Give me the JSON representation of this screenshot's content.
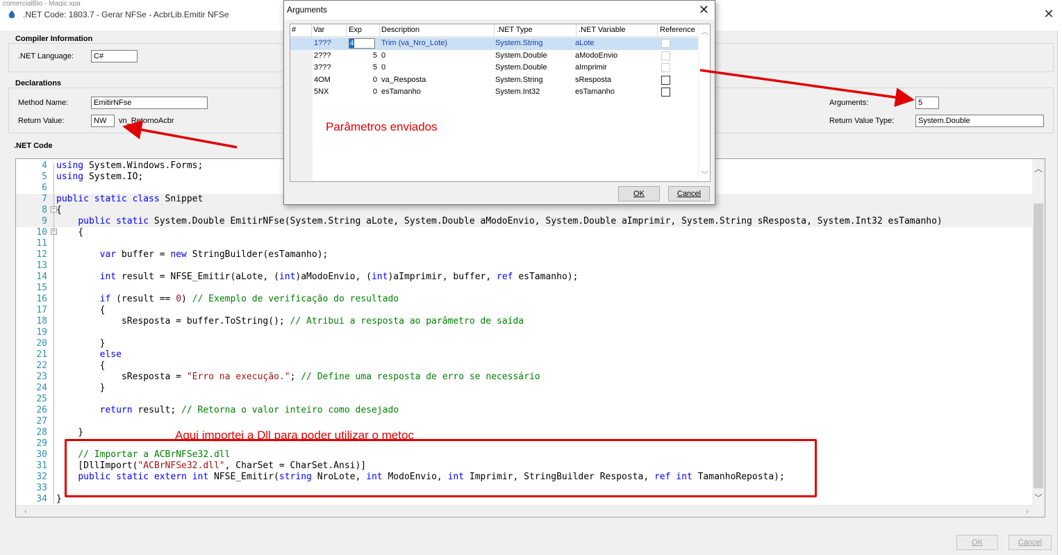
{
  "background_window": {
    "title_fragment": "comercialBio - Magic.xpa"
  },
  "window": {
    "title": ".NET Code: 1803.7 -   Gerar NFSe - AcbrLib.Emitir NFSe",
    "close_glyph": "✕"
  },
  "compiler": {
    "section_label": "Compiler Information",
    "language_label": ".NET Language:",
    "language_value": "C#"
  },
  "declarations": {
    "section_label": "Declarations",
    "method_name_label": "Method Name:",
    "method_name_value": "EmitirNFse",
    "return_value_label": "Return Value:",
    "return_value_var": "NW",
    "return_value_name": "vn_RetornoAcbr",
    "arguments_label": "Arguments:",
    "arguments_value": "5",
    "return_type_label": "Return Value Type:",
    "return_type_value": "System.Double"
  },
  "code_section": {
    "label": ".NET Code"
  },
  "code_lines": [
    {
      "n": "4",
      "t": [
        [
          "kw",
          "using"
        ],
        [
          "tx",
          " System.Windows.Forms;"
        ]
      ]
    },
    {
      "n": "5",
      "t": [
        [
          "kw",
          "using"
        ],
        [
          "tx",
          " System.IO;"
        ]
      ]
    },
    {
      "n": "6",
      "t": []
    },
    {
      "n": "7",
      "t": [
        [
          "kw",
          "public static class"
        ],
        [
          "tx",
          " Snippet"
        ]
      ],
      "hl": true
    },
    {
      "n": "8",
      "t": [
        [
          "tx",
          "{"
        ]
      ],
      "hl": true,
      "fold": true
    },
    {
      "n": "9",
      "t": [
        [
          "tx",
          "    "
        ],
        [
          "kw",
          "public static"
        ],
        [
          "tx",
          " System.Double EmitirNFse(System.String aLote, System.Double aModoEnvio, System.Double aImprimir, System.String sResposta, System.Int32 esTamanho)"
        ]
      ],
      "hl": true
    },
    {
      "n": "10",
      "t": [
        [
          "tx",
          "    {"
        ]
      ],
      "fold": true
    },
    {
      "n": "11",
      "t": []
    },
    {
      "n": "12",
      "t": [
        [
          "tx",
          "        "
        ],
        [
          "kw",
          "var"
        ],
        [
          "tx",
          " buffer = "
        ],
        [
          "kw",
          "new"
        ],
        [
          "tx",
          " StringBuilder(esTamanho);"
        ]
      ]
    },
    {
      "n": "13",
      "t": []
    },
    {
      "n": "14",
      "t": [
        [
          "tx",
          "        "
        ],
        [
          "kw",
          "int"
        ],
        [
          "tx",
          " result = NFSE_Emitir(aLote, ("
        ],
        [
          "kw",
          "int"
        ],
        [
          "tx",
          ")aModoEnvio, ("
        ],
        [
          "kw",
          "int"
        ],
        [
          "tx",
          ")aImprimir, buffer, "
        ],
        [
          "kw",
          "ref"
        ],
        [
          "tx",
          " esTamanho);"
        ]
      ]
    },
    {
      "n": "15",
      "t": []
    },
    {
      "n": "16",
      "t": [
        [
          "tx",
          "        "
        ],
        [
          "kw",
          "if"
        ],
        [
          "tx",
          " (result == "
        ],
        [
          "st",
          "0"
        ],
        [
          "tx",
          ") "
        ],
        [
          "cm",
          "// Exemplo de verificação do resultado"
        ]
      ]
    },
    {
      "n": "17",
      "t": [
        [
          "tx",
          "        {"
        ]
      ]
    },
    {
      "n": "18",
      "t": [
        [
          "tx",
          "            sResposta = buffer.ToString(); "
        ],
        [
          "cm",
          "// Atribui a resposta ao parâmetro de saída"
        ]
      ]
    },
    {
      "n": "19",
      "t": []
    },
    {
      "n": "20",
      "t": [
        [
          "tx",
          "        }"
        ]
      ]
    },
    {
      "n": "21",
      "t": [
        [
          "tx",
          "        "
        ],
        [
          "kw",
          "else"
        ]
      ]
    },
    {
      "n": "22",
      "t": [
        [
          "tx",
          "        {"
        ]
      ]
    },
    {
      "n": "23",
      "t": [
        [
          "tx",
          "            sResposta = "
        ],
        [
          "st",
          "\"Erro na execução.\""
        ],
        [
          "tx",
          "; "
        ],
        [
          "cm",
          "// Define uma resposta de erro se necessário"
        ]
      ]
    },
    {
      "n": "24",
      "t": [
        [
          "tx",
          "        }"
        ]
      ]
    },
    {
      "n": "25",
      "t": []
    },
    {
      "n": "26",
      "t": [
        [
          "tx",
          "        "
        ],
        [
          "kw",
          "return"
        ],
        [
          "tx",
          " result; "
        ],
        [
          "cm",
          "// Retorna o valor inteiro como desejado"
        ]
      ]
    },
    {
      "n": "27",
      "t": []
    },
    {
      "n": "28",
      "t": [
        [
          "tx",
          "    }"
        ]
      ]
    },
    {
      "n": "29",
      "t": []
    },
    {
      "n": "30",
      "t": [
        [
          "tx",
          "    "
        ],
        [
          "cm",
          "// Importar a ACBrNFSe32.dll"
        ]
      ]
    },
    {
      "n": "31",
      "t": [
        [
          "tx",
          "    [DllImport("
        ],
        [
          "st",
          "\"ACBrNFSe32.dll\""
        ],
        [
          "tx",
          ", CharSet = CharSet.Ansi)]"
        ]
      ]
    },
    {
      "n": "32",
      "t": [
        [
          "tx",
          "    "
        ],
        [
          "kw",
          "public static extern int"
        ],
        [
          "tx",
          " NFSE_Emitir("
        ],
        [
          "kw",
          "string"
        ],
        [
          "tx",
          " NroLote, "
        ],
        [
          "kw",
          "int"
        ],
        [
          "tx",
          " ModoEnvio, "
        ],
        [
          "kw",
          "int"
        ],
        [
          "tx",
          " Imprimir, StringBuilder Resposta, "
        ],
        [
          "kw",
          "ref int"
        ],
        [
          "tx",
          " TamanhoReposta);"
        ]
      ]
    },
    {
      "n": "33",
      "t": []
    },
    {
      "n": "34",
      "t": [
        [
          "tx",
          "}"
        ]
      ]
    }
  ],
  "buttons": {
    "ok": "OK",
    "cancel": "Cancel"
  },
  "arguments_dialog": {
    "title": "Arguments",
    "close_glyph": "✕",
    "columns": [
      "#",
      "Var",
      "Exp",
      "Description",
      ".NET Type",
      ".NET Variable",
      "Reference"
    ],
    "rows": [
      {
        "var": "1???",
        "exp": "",
        "description": "Trim (va_Nro_Lote)",
        "type": "System.String",
        "variable": "aLote",
        "reference": false,
        "ref_enabled": false,
        "selected": true
      },
      {
        "var": "2???",
        "exp": "5",
        "description": "0",
        "type": "System.Double",
        "variable": "aModoEnvio",
        "reference": false,
        "ref_enabled": false,
        "selected": false
      },
      {
        "var": "3???",
        "exp": "5",
        "description": "0",
        "type": "System.Double",
        "variable": "aImprimir",
        "reference": false,
        "ref_enabled": false,
        "selected": false
      },
      {
        "var": "4OM",
        "exp": "0",
        "description": "va_Resposta",
        "type": "System.String",
        "variable": "sResposta",
        "reference": false,
        "ref_enabled": true,
        "selected": false
      },
      {
        "var": "5NX",
        "exp": "0",
        "description": "esTamanho",
        "type": "System.Int32",
        "variable": "esTamanho",
        "reference": false,
        "ref_enabled": true,
        "selected": false
      }
    ],
    "exp_edit_value": "4",
    "ok": "OK",
    "cancel": "Cancel"
  },
  "annotations": {
    "params_note": "Parâmetros enviados",
    "dll_note": "Aqui importei a Dll para poder utilizar o metoc",
    "color": "#e00000"
  },
  "colors": {
    "keyword": "#0000ff",
    "comment": "#008000",
    "string": "#a31515",
    "line_number": "#2b91af",
    "selection": "#cce0f5"
  }
}
